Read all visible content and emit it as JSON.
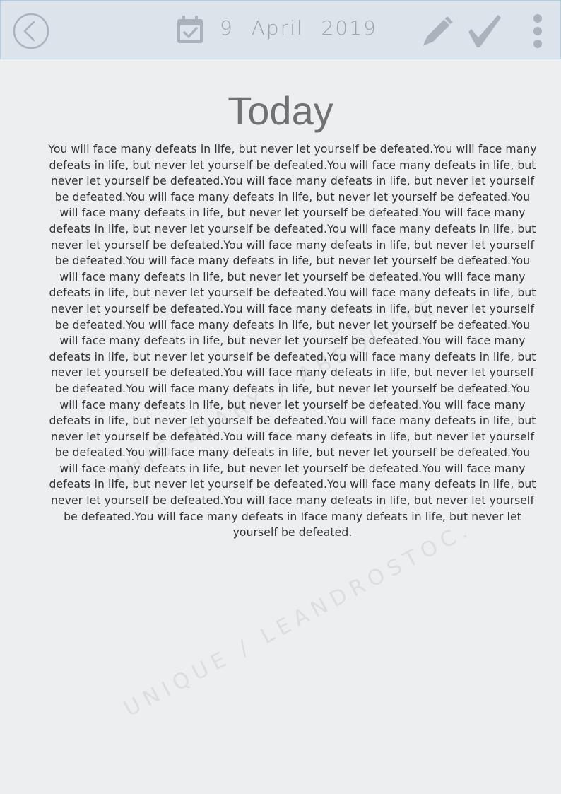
{
  "header": {
    "date_text": "9 April 2019",
    "icons": {
      "back": "back-arrow-circle-icon",
      "calendar": "calendar-check-icon",
      "edit": "pencil-icon",
      "confirm": "checkmark-icon",
      "menu": "more-vertical-icon"
    },
    "icon_color": "#aab3bb",
    "background": "#dce3ea"
  },
  "main": {
    "title": "Today",
    "body": "You will face many defeats in life, but never let yourself be defeated.You will face many defeats in life, but never let yourself be defeated.You will face many defeats in life, but never let yourself be defeated.You will face many defeats in life, but never let yourself be defeated.You will face many defeats in life, but never let yourself be defeated.You will face many defeats in life, but never let yourself be defeated.You will face many defeats in life, but never let yourself be defeated.You will face many defeats in life, but never let yourself be defeated.You will face many defeats in life, but never let yourself be defeated.You will face many defeats in life, but never let yourself be defeated.You will face many defeats in life, but never let yourself be defeated.You will face many defeats in life, but never let yourself be defeated.You will face many defeats in life, but never let yourself be defeated.You will face many defeats in life, but never let yourself be defeated.You will face many defeats in life, but never let yourself be defeated.You will face many defeats in life, but never let yourself be defeated.You will face many defeats in life, but never let yourself be defeated.You will face many defeats in life, but never let yourself be defeated.You will face many defeats in life, but never let yourself be defeated.You will face many defeats in life, but never let yourself be defeated.You will face many defeats in life, but never let yourself be defeated.You will face many defeats in life, but never let yourself be defeated.You will face many defeats in life, but never let yourself be defeated.You will face many defeats in life, but never let yourself be defeated.You will face many defeats in life, but never let yourself be defeated.You will face many defeats in life, but never let yourself be defeated.You will face many defeats in life, but never let yourself be defeated.You will face many defeats in life, but never let yourself be defeated.You will face many defeats in life, but never let yourself be defeated.You will face many defeats in Iface many defeats in life, but never let yourself be defeated."
  },
  "watermark": {
    "line1": "THIS DIARY / ABSOLUTE.",
    "line2": "UNIQUE / LEANDROSTOC."
  }
}
